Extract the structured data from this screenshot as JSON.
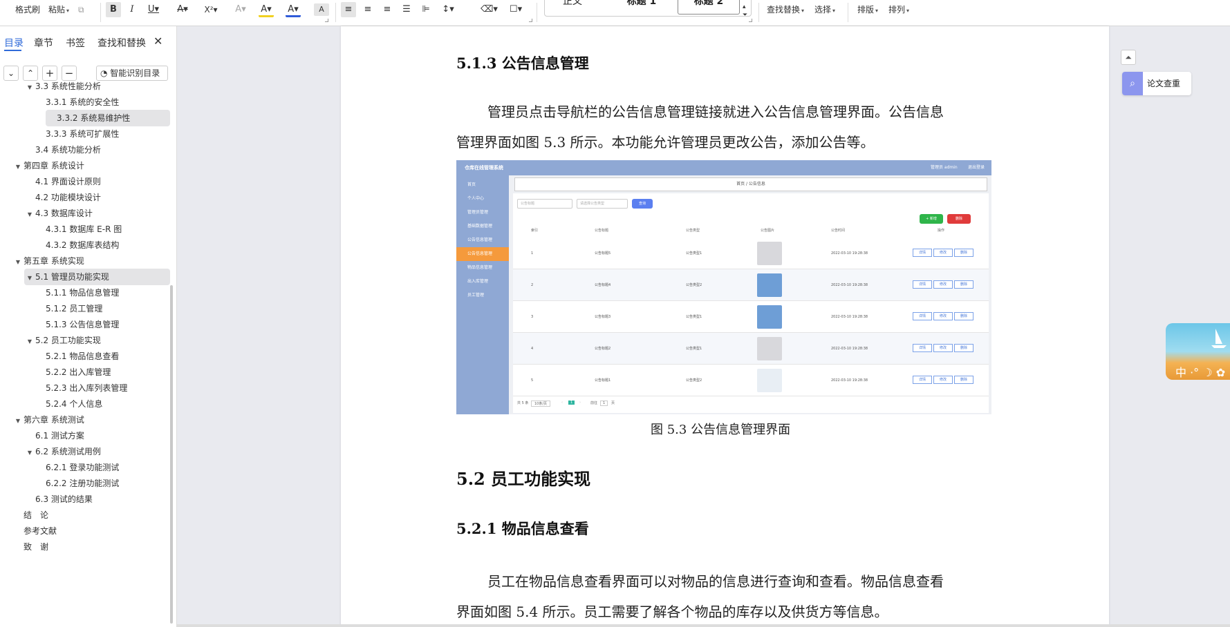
{
  "toolbar": {
    "format_brush": "格式刷",
    "paste": "粘贴",
    "bold": "B",
    "italic": "I",
    "underline": "U",
    "strikethrough": "A",
    "superscript": "X²",
    "text_effect": "A",
    "highlight": "A",
    "font_color": "A",
    "char_shading": "A",
    "style_normal": "正文",
    "style_h1": "标题 1",
    "style_h2": "标题 2",
    "find_replace": "查找替换",
    "select": "选择",
    "layout": "排版",
    "arrange": "排列",
    "colors": {
      "font_color_bar": "#2f5bd9",
      "highlight_bar": "#f0d020"
    }
  },
  "sidebar": {
    "tabs": [
      "目录",
      "章节",
      "书签",
      "查找和替换"
    ],
    "close": "✕",
    "smart_toc": "智能识别目录",
    "toc": [
      {
        "label": "3.3 系统性能分析",
        "level": 1,
        "expand": true
      },
      {
        "label": "3.3.1 系统的安全性",
        "level": 2
      },
      {
        "label": "3.3.2 系统易维护性",
        "level": 2,
        "selected": true
      },
      {
        "label": "3.3.3 系统可扩展性",
        "level": 2
      },
      {
        "label": "3.4 系统功能分析",
        "level": 1
      },
      {
        "label": "第四章  系统设计",
        "level": 0,
        "expand": true
      },
      {
        "label": "4.1 界面设计原则",
        "level": 1
      },
      {
        "label": "4.2 功能模块设计",
        "level": 1
      },
      {
        "label": "4.3 数据库设计",
        "level": 1,
        "expand": true
      },
      {
        "label": "4.3.1 数据库 E-R 图",
        "level": 2
      },
      {
        "label": "4.3.2  数据库表结构",
        "level": 2
      },
      {
        "label": "第五章  系统实现",
        "level": 0,
        "expand": true
      },
      {
        "label": "5.1  管理员功能实现",
        "level": 1,
        "expand": true,
        "selected": true
      },
      {
        "label": "5.1.1  物品信息管理",
        "level": 2
      },
      {
        "label": "5.1.2  员工管理",
        "level": 2
      },
      {
        "label": "5.1.3  公告信息管理",
        "level": 2
      },
      {
        "label": "5.2  员工功能实现",
        "level": 1,
        "expand": true
      },
      {
        "label": "5.2.1  物品信息查看",
        "level": 2
      },
      {
        "label": "5.2.2  出入库管理",
        "level": 2
      },
      {
        "label": "5.2.3  出入库列表管理",
        "level": 2
      },
      {
        "label": "5.2.4  个人信息",
        "level": 2
      },
      {
        "label": "第六章  系统测试",
        "level": 0,
        "expand": true
      },
      {
        "label": "6.1  测试方案",
        "level": 1
      },
      {
        "label": "6.2  系统测试用例",
        "level": 1,
        "expand": true
      },
      {
        "label": "6.2.1  登录功能测试",
        "level": 2
      },
      {
        "label": "6.2.2  注册功能测试",
        "level": 2
      },
      {
        "label": "6.3  测试的结果",
        "level": 1
      },
      {
        "label": "结　论",
        "level": 0
      },
      {
        "label": "参考文献",
        "level": 0
      },
      {
        "label": "致　谢",
        "level": 0
      }
    ]
  },
  "document": {
    "h_513": "5.1.3  公告信息管理",
    "p1_line1": "管理员点击导航栏的公告信息管理链接就进入公告信息管理界面。公告信息",
    "p1_line2": "管理界面如图 5.3 所示。本功能允许管理员更改公告，添加公告等。",
    "caption": "图 5.3  公告信息管理界面",
    "h_52": "5.2  员工功能实现",
    "h_521": "5.2.1  物品信息查看",
    "p2_line1": "员工在物品信息查看界面可以对物品的信息进行查询和查看。物品信息查看",
    "p2_line2": "界面如图 5.4 所示。员工需要了解各个物品的库存以及供货方等信息。"
  },
  "figure": {
    "app_title": "仓库在线管理系统",
    "user": "管理员 admin",
    "logout": "退出登录",
    "menu": [
      "首页",
      "个人中心",
      "管理员管理",
      "基础数据管理",
      "公告信息管理",
      "公告信息管理",
      "物品信息管理",
      "出入库管理",
      "员工管理"
    ],
    "crumb": "首页 / 公告信息",
    "search_title": "公告标题",
    "search_type": "请选择公告类型",
    "query": "查询",
    "add": "+ 新增",
    "delete": "删除",
    "headers": [
      "索引",
      "公告标题",
      "公告类型",
      "公告图片",
      "公告时间",
      "操作"
    ],
    "rows": [
      {
        "idx": "1",
        "title": "公告标题5",
        "type": "公告类型1",
        "time": "2022-03-10 19:28:38"
      },
      {
        "idx": "2",
        "title": "公告标题4",
        "type": "公告类型2",
        "time": "2022-03-10 19:28:38"
      },
      {
        "idx": "3",
        "title": "公告标题3",
        "type": "公告类型1",
        "time": "2022-03-10 19:28:38"
      },
      {
        "idx": "4",
        "title": "公告标题2",
        "type": "公告类型1",
        "time": "2022-03-10 19:28:38"
      },
      {
        "idx": "5",
        "title": "公告标题1",
        "type": "公告类型2",
        "time": "2022-03-10 19:28:38"
      }
    ],
    "actions": [
      "详情",
      "修改",
      "删除"
    ],
    "footer_total": "共 5 条",
    "footer_size": "10条/页",
    "footer_page": "1",
    "footer_goto": "前往",
    "footer_goto_page": "1",
    "footer_unit": "页"
  },
  "right_panel": {
    "collapse": "⏶",
    "plagiarism_check": "论文查重",
    "beach_text": "中 ·° ☽ ✿"
  }
}
